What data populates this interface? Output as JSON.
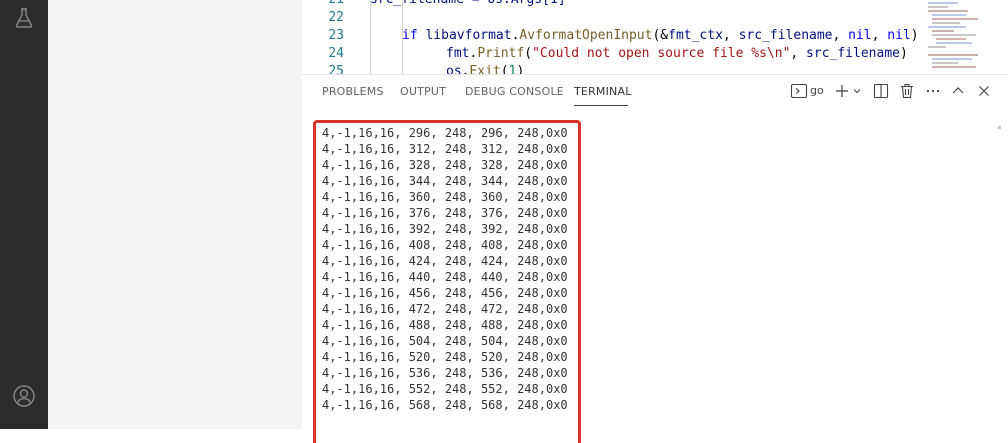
{
  "editor": {
    "lines": [
      {
        "num": "21",
        "text": "src_filename = os.Args[1]"
      },
      {
        "num": "22",
        "text": ""
      },
      {
        "num": "23",
        "text": "if libavformat.AvformatOpenInput(&fmt_ctx, src_filename, nil, nil)"
      },
      {
        "num": "24",
        "text": "fmt.Printf(\"Could not open source file %s\\n\", src_filename)"
      },
      {
        "num": "25",
        "text": "os.Exit(1)"
      }
    ]
  },
  "panel": {
    "tabs": [
      "PROBLEMS",
      "OUTPUT",
      "DEBUG CONSOLE",
      "TERMINAL"
    ],
    "active_tab": "TERMINAL",
    "terminal_name": "go"
  },
  "terminal_lines": [
    "4,-1,16,16, 296, 248, 296, 248,0x0",
    "4,-1,16,16, 312, 248, 312, 248,0x0",
    "4,-1,16,16, 328, 248, 328, 248,0x0",
    "4,-1,16,16, 344, 248, 344, 248,0x0",
    "4,-1,16,16, 360, 248, 360, 248,0x0",
    "4,-1,16,16, 376, 248, 376, 248,0x0",
    "4,-1,16,16, 392, 248, 392, 248,0x0",
    "4,-1,16,16, 408, 248, 408, 248,0x0",
    "4,-1,16,16, 424, 248, 424, 248,0x0",
    "4,-1,16,16, 440, 248, 440, 248,0x0",
    "4,-1,16,16, 456, 248, 456, 248,0x0",
    "4,-1,16,16, 472, 248, 472, 248,0x0",
    "4,-1,16,16, 488, 248, 488, 248,0x0",
    "4,-1,16,16, 504, 248, 504, 248,0x0",
    "4,-1,16,16, 520, 248, 520, 248,0x0",
    "4,-1,16,16, 536, 248, 536, 248,0x0",
    "4,-1,16,16, 552, 248, 552, 248,0x0",
    "4,-1,16,16, 568, 248, 568, 248,0x0"
  ],
  "colors": {
    "activity_bar": "#2c2c2c",
    "sidebar": "#f3f3f3",
    "highlight_border": "#d9342b",
    "line_number": "#237893"
  },
  "icons": [
    "flask-icon",
    "account-icon",
    "terminal-icon",
    "plus-icon",
    "chevron-down-icon",
    "split-icon",
    "trash-icon",
    "more-icon",
    "chevron-up-icon",
    "close-icon"
  ]
}
